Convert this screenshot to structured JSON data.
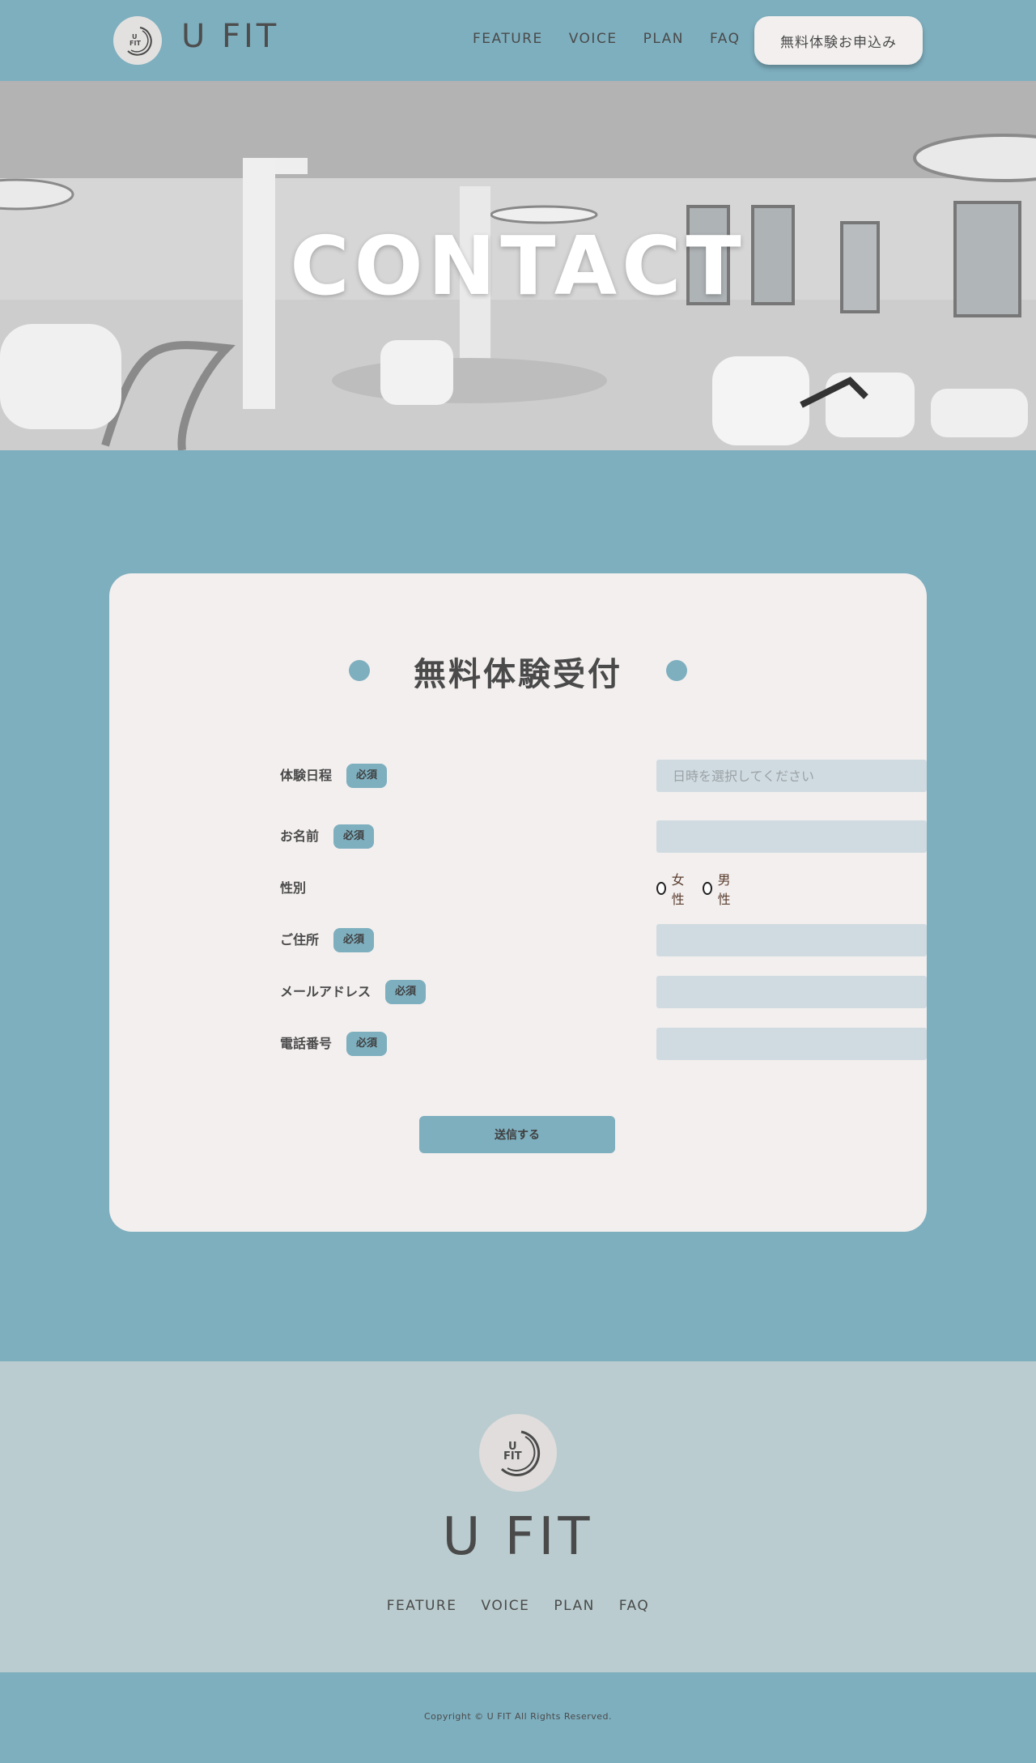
{
  "colors": {
    "primary": "#7eafbf",
    "card": "#f3efee",
    "input": "#d0dbe1",
    "footer": "#bacccf",
    "text": "#4a4a4a"
  },
  "header": {
    "logo_icon": "u-fit-logo-icon",
    "logo_text": "U\nFIT",
    "brand": "U FIT",
    "nav": [
      "FEATURE",
      "VOICE",
      "PLAN",
      "FAQ"
    ],
    "cta": "無料体験お申込み"
  },
  "hero": {
    "title": "CONTACT"
  },
  "form": {
    "heading": "無料体験受付",
    "required": "必須",
    "fields": {
      "date": {
        "label": "体験日程",
        "placeholder": "日時を選択してください"
      },
      "name": {
        "label": "お名前"
      },
      "gender": {
        "label": "性別",
        "options": [
          "女性",
          "男性"
        ]
      },
      "address": {
        "label": "ご住所"
      },
      "email": {
        "label": "メールアドレス"
      },
      "phone": {
        "label": "電話番号"
      }
    },
    "submit": "送信する"
  },
  "footer": {
    "brand": "U FIT",
    "nav": [
      "FEATURE",
      "VOICE",
      "PLAN",
      "FAQ"
    ],
    "copyright": "Copyright © U FIT All Rights Reserved."
  }
}
